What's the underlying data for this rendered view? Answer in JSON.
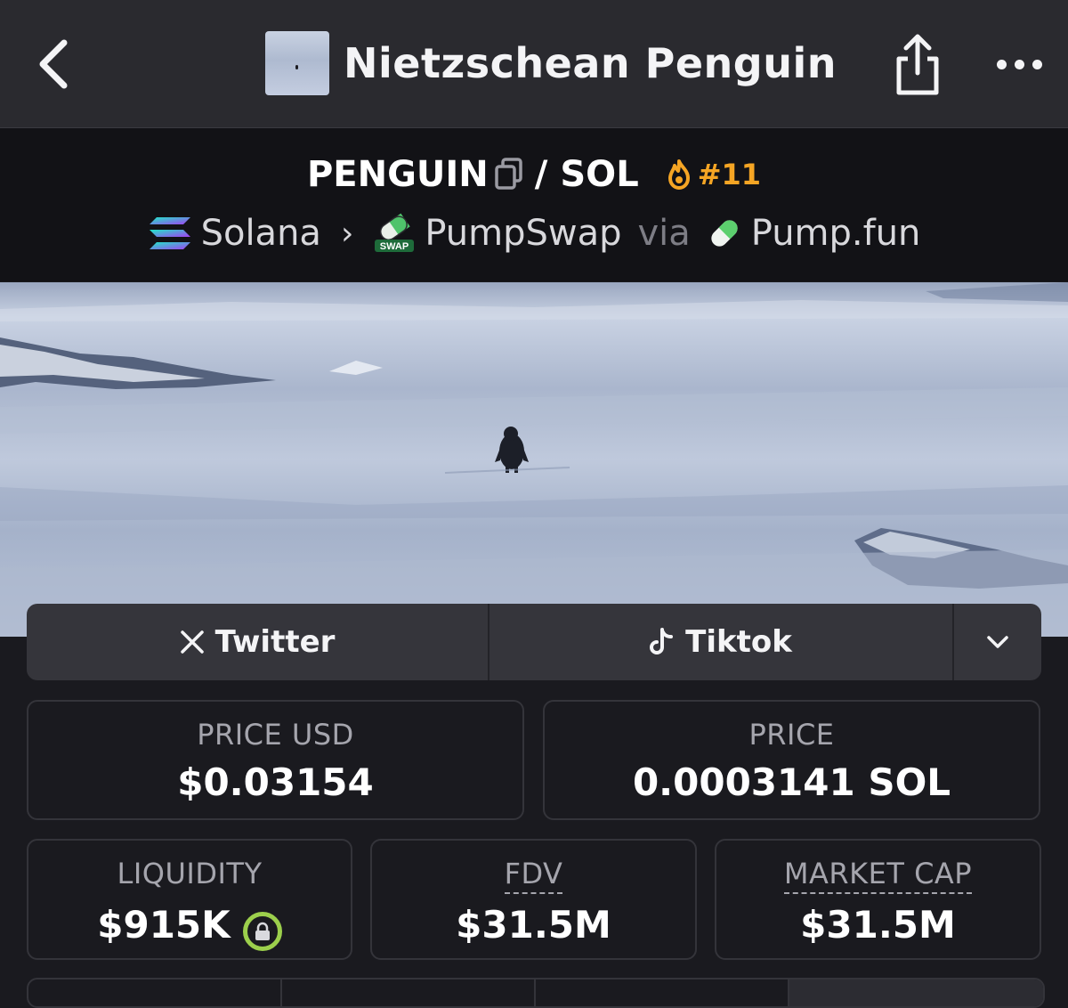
{
  "nav": {
    "title": "Nietzschean Penguin",
    "back_icon": "chevron-left-icon",
    "share_icon": "share-icon",
    "more_icon": "more-horizontal-icon"
  },
  "pair": {
    "base": "PENGUIN",
    "separator": "/",
    "quote": "SOL",
    "rank": "#11",
    "rank_color": "#f5a524"
  },
  "route": {
    "chain": "Solana",
    "dex": "PumpSwap",
    "dex_icon_text": "SWAP",
    "via": "via",
    "launchpad": "Pump.fun"
  },
  "socials": [
    {
      "label": "Twitter",
      "icon": "x-logo-icon"
    },
    {
      "label": "Tiktok",
      "icon": "tiktok-icon"
    }
  ],
  "stats": {
    "price_usd": {
      "label": "PRICE USD",
      "value": "$0.03154"
    },
    "price": {
      "label": "PRICE",
      "value": "0.0003141 SOL"
    },
    "liquidity": {
      "label": "LIQUIDITY",
      "value": "$915K"
    },
    "fdv": {
      "label": "FDV",
      "value": "$31.5M"
    },
    "market_cap": {
      "label": "MARKET CAP",
      "value": "$31.5M"
    }
  },
  "colors": {
    "background": "#1a1a1f",
    "header": "#2a2a2f",
    "accent_orange": "#f5a524",
    "lock_green": "#9ccf4c"
  }
}
